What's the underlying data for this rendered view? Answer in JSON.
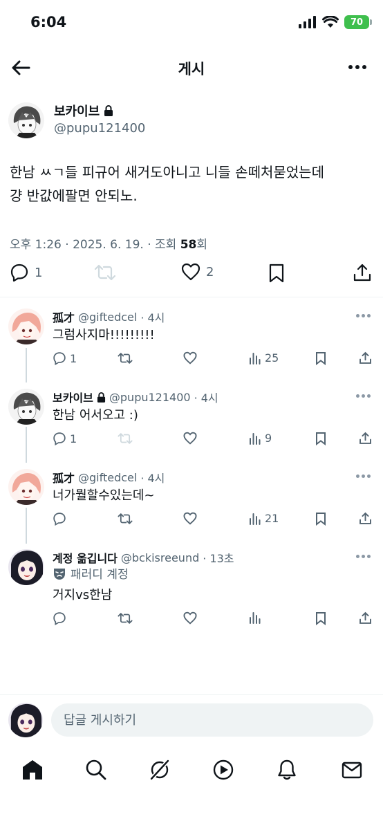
{
  "status_bar": {
    "time": "6:04",
    "battery": "70"
  },
  "header": {
    "title": "게시"
  },
  "post": {
    "author_name": "보카이브",
    "author_handle": "@pupu121400",
    "text_line1": "한남 ㅆㄱ들 피규어 새거도아니고 니들 손떼처묻었는데",
    "text_line2": "걍 반값에팔면 안되노.",
    "meta_prefix": "오후 1:26 · 2025. 6. 19. · 조회 ",
    "views": "58",
    "views_suffix": "회",
    "replies": "1",
    "likes": "2"
  },
  "replies": [
    {
      "name": "孤才",
      "handle": "@giftedcel",
      "time": "· 4시",
      "text": "그럼사지마!!!!!!!!!",
      "reply_count": "1",
      "views": "25"
    },
    {
      "name": "보카이브",
      "handle": "@pupu121400",
      "time": "· 4시",
      "text": "한남 어서오고 :)",
      "reply_count": "1",
      "views": "9"
    },
    {
      "name": "孤才",
      "handle": "@giftedcel",
      "time": "· 4시",
      "text": "너가뭘할수있는데~",
      "reply_count": "",
      "views": "21"
    },
    {
      "name": "계정 옮깁니다",
      "handle": "@bckisreeund",
      "time": "· 13초",
      "parody_label": "패러디 계정",
      "text": "거지vs한남",
      "reply_count": "",
      "views": ""
    }
  ],
  "composer": {
    "placeholder": "답글 게시하기"
  },
  "icons": {
    "nav": [
      "home-icon",
      "search-icon",
      "grok-icon",
      "video-icon",
      "notifications-icon",
      "messages-icon"
    ]
  },
  "colors": {
    "text": "#0f1419",
    "muted": "#536471",
    "battery": "#3fbf4d"
  }
}
